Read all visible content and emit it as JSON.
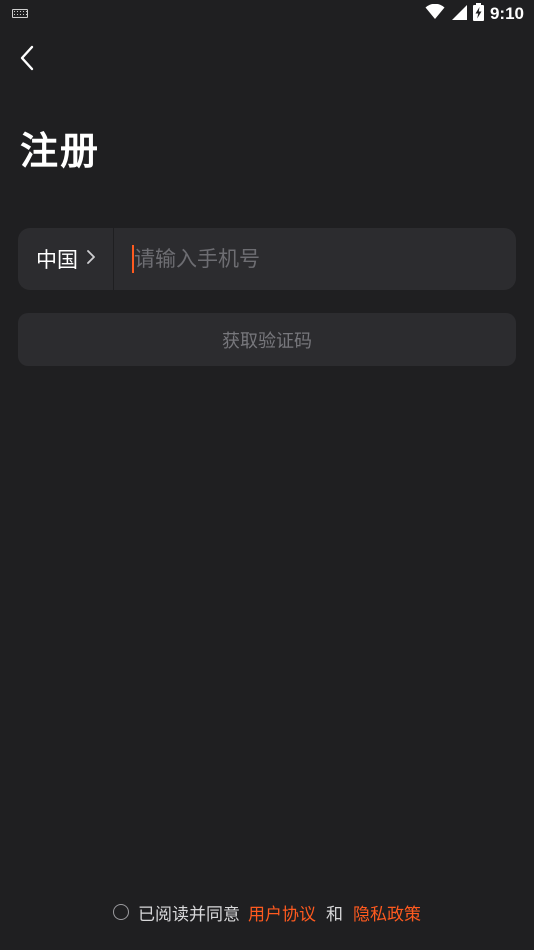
{
  "status_bar": {
    "time": "9:10",
    "icons": [
      "keyboard-icon",
      "wifi-icon",
      "signal-icon",
      "battery-charging-icon"
    ]
  },
  "header": {
    "back_icon": "chevron-left-icon"
  },
  "title": "注册",
  "phone_form": {
    "country": "中国",
    "country_chevron": "chevron-right-icon",
    "phone_placeholder": "请输入手机号",
    "phone_value": ""
  },
  "get_code_button": {
    "label": "获取验证码"
  },
  "agreement": {
    "prefix": "已阅读并同意",
    "user_agreement": "用户协议",
    "and": "和",
    "privacy_policy": "隐私政策",
    "checked": false
  },
  "colors": {
    "background": "#1f1f21",
    "field_bg": "#2c2c2f",
    "accent": "#ff5a1f",
    "placeholder": "#6d6d72"
  }
}
